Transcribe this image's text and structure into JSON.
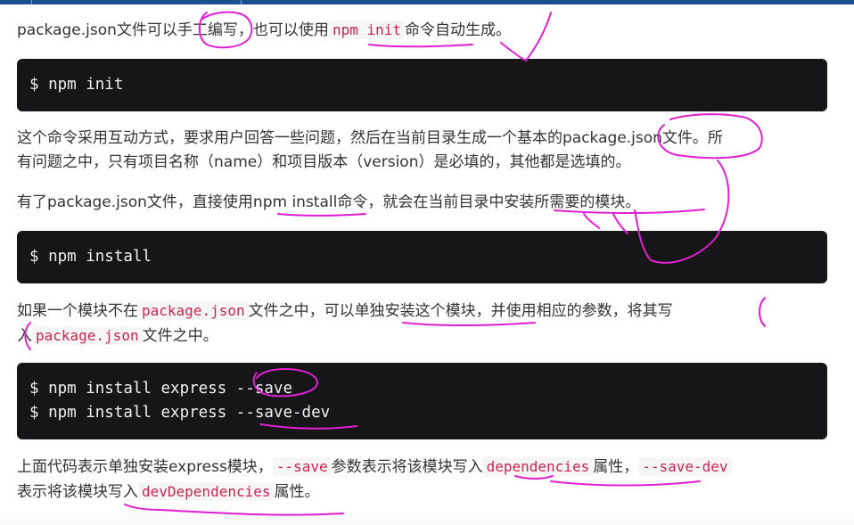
{
  "p1": {
    "t1": "package.json文件可以手工编写，也可以使用",
    "c1": "npm init",
    "t2": "命令自动生成。"
  },
  "code1": [
    "$ npm init"
  ],
  "p2": {
    "line1": "这个命令采用互动方式，要求用户回答一些问题，然后在当前目录生成一个基本的package.json文件。所",
    "line2": "有问题之中，只有项目名称（name）和项目版本（version）是必填的，其他都是选填的。"
  },
  "p3": "有了package.json文件，直接使用npm install命令，就会在当前目录中安装所需要的模块。",
  "code2": [
    "$ npm install"
  ],
  "p4": {
    "t1": "如果一个模块不在",
    "c1": "package.json",
    "t2": "文件之中，可以单独安装这个模块，并使用相应的参数，将其写",
    "t3": "入",
    "c2": "package.json",
    "t4": "文件之中。"
  },
  "code3": [
    "$ npm install express --save",
    "$ npm install express --save-dev"
  ],
  "p5": {
    "t1": "上面代码表示单独安装express模块，",
    "c1": "--save",
    "t2": "参数表示将该模块写入",
    "c2": "dependencies",
    "t3": "属性，",
    "c3": "--save-dev",
    "t4": "表示将该模块写入",
    "c4": "devDependencies",
    "t5": "属性。"
  },
  "colors": {
    "inline_code": "#c7254e",
    "code_bg": "#161618",
    "annotation": "#e020d0"
  }
}
